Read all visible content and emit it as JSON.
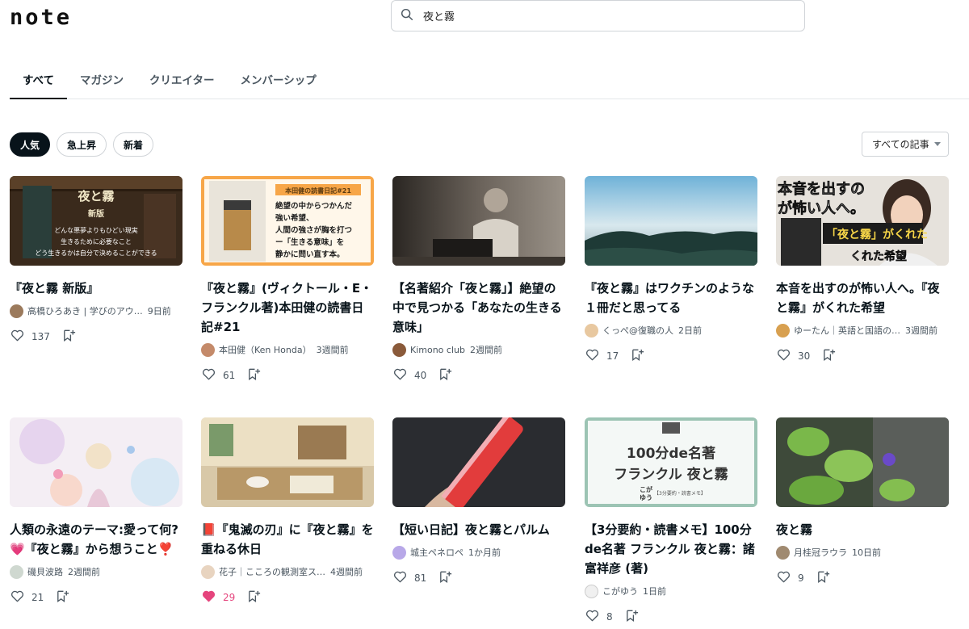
{
  "header": {
    "logo": "note",
    "search_value": "夜と霧"
  },
  "tabs": [
    {
      "label": "すべて"
    },
    {
      "label": "マガジン"
    },
    {
      "label": "クリエイター"
    },
    {
      "label": "メンバーシップ"
    }
  ],
  "filters": [
    {
      "label": "人気"
    },
    {
      "label": "急上昇"
    },
    {
      "label": "新着"
    }
  ],
  "sort_label": "すべての記事",
  "icons": {
    "search": "search-icon",
    "like": "heart-icon",
    "save": "bookmark-add-icon",
    "caret": "caret-down-icon"
  },
  "colors": {
    "text": "#08131a",
    "sub": "#4a5660",
    "liked": "#e5457d"
  },
  "cards": [
    {
      "title": "『夜と霧 新版』",
      "author": "高橋ひろあき | 学びのアウ…",
      "time": "9日前",
      "likes": "137",
      "thumb_text": [
        "夜と霧",
        "新版",
        "どんな悪夢よりもひどい現実",
        "生きるために必要なこと",
        "どう生きるかは自分で決めることができる"
      ]
    },
    {
      "title": "『夜と霧』(ヴィクトール・E・フランクル著)本田健の読書日記#21",
      "author": "本田健（Ken Honda）",
      "time": "3週間前",
      "likes": "61",
      "thumb_text": [
        "本田健の読書日記#21",
        "絶望の中からつかんだ",
        "強い希望、",
        "人間の強さが胸を打つ",
        "ー「生きる意味」を",
        "静かに問い直す本。"
      ]
    },
    {
      "title": "【名著紹介「夜と霧」】絶望の中で見つかる「あなたの生きる意味」",
      "author": "Kimono club",
      "time": "2週間前",
      "likes": "40"
    },
    {
      "title": "『夜と霧』はワクチンのような１冊だと思ってる",
      "author": "くっぺ@復職の人",
      "time": "2日前",
      "likes": "17"
    },
    {
      "title": "本音を出すのが怖い人へ。『夜と霧』がくれた希望",
      "author": "ゆーたん｜英語と国語の…",
      "time": "3週間前",
      "likes": "30",
      "thumb_text": [
        "本音を出すの",
        "が怖い人へ。",
        "「夜と霧」がくれた",
        "くれた希望"
      ]
    },
    {
      "title": "人類の永遠のテーマ:愛って何?💗『夜と霧』から想うこと❣️",
      "author": "磯貝波路",
      "time": "2週間前",
      "likes": "21"
    },
    {
      "title": "📕『鬼滅の刃』に『夜と霧』を重ねる休日",
      "author": "花子｜こころの観測室ス…",
      "time": "4週間前",
      "likes": "29",
      "liked": true
    },
    {
      "title": "【短い日記】夜と霧とパルム",
      "author": "城主ペネロペ",
      "time": "1か月前",
      "likes": "81"
    },
    {
      "title": "【3分要約・読書メモ】100分de名著 フランクル 夜と霧：諸富祥彦 (著)",
      "author": "こがゆう",
      "time": "1日前",
      "likes": "8",
      "thumb_text": [
        "100分de名著",
        "フランクル 夜と霧",
        "こが",
        "ゆう",
        "【3分要約・読書メモ】"
      ]
    },
    {
      "title": "夜と霧",
      "author": "月桂冠ラウラ",
      "time": "10日前",
      "likes": "9"
    }
  ]
}
